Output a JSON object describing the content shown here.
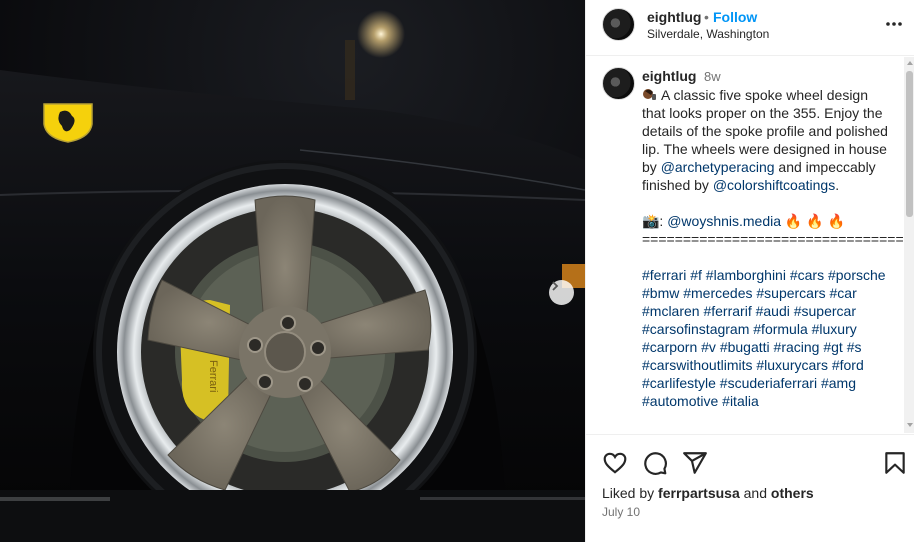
{
  "post": {
    "username": "eightlug",
    "separator": "•",
    "follow_label": "Follow",
    "location": "Silverdale, Washington"
  },
  "caption": {
    "username": "eightlug",
    "time_ago": "8w",
    "emoji_icon": "driver-emoji-icon",
    "text_intro": "A classic five spoke wheel design that looks proper on the 355. Enjoy the details of the spoke profile and polished lip. The wheels were designed in house by ",
    "mention_1": "@archetyperacing",
    "text_mid": " and impeccably finished by ",
    "mention_2": "@colorshiftcoatings",
    "text_end": ".",
    "credit_prefix": "📸: ",
    "credit_mention": "@woyshnis.media",
    "credit_suffix": " 🔥 🔥 🔥",
    "divider": "=================================",
    "hashtags": "#ferrari #f #lamborghini #cars #porsche #bmw #mercedes #supercars #car #mclaren #ferrarif #audi #supercar #carsofinstagram #formula #luxury #carporn #v #bugatti #racing #gt #s #carswithoutlimits #luxurycars #ford #carlifestyle #scuderiaferrari #amg #automotive #italia"
  },
  "actions": {
    "like_icon": "heart-icon",
    "comment_icon": "comment-icon",
    "share_icon": "send-icon",
    "save_icon": "bookmark-icon"
  },
  "likes": {
    "prefix": "Liked by ",
    "user": "ferrpartsusa",
    "middle": " and ",
    "others": "others"
  },
  "date": "July 10",
  "colors": {
    "follow": "#0095f6",
    "link": "#00376b",
    "secondary_text": "#737373",
    "ferrari_badge": "#f5d10c"
  }
}
